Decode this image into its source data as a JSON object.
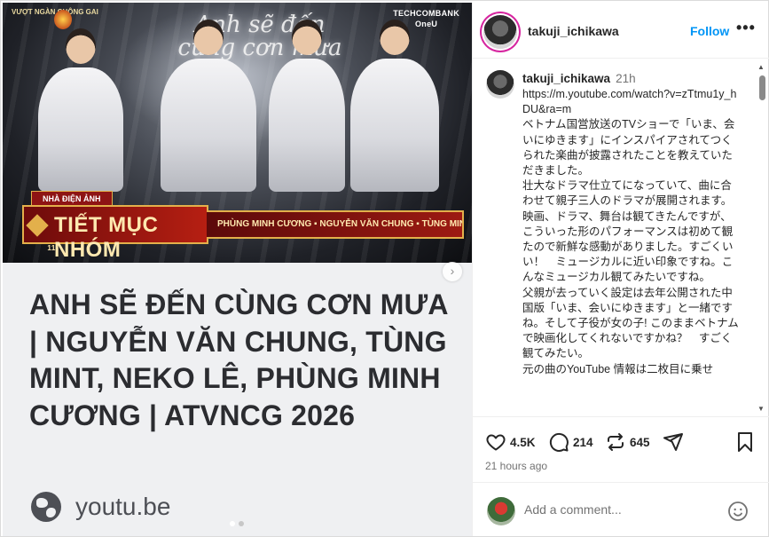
{
  "media": {
    "thumbnail": {
      "show_logo": "VƯỢT NGÀN CHÔNG GAI",
      "sponsor_line1": "TECHCOMBANK",
      "sponsor_line2": "OneU",
      "script_title": "Anh sẽ đến cùng cơn mưa",
      "tag": "NHÀ ĐIỆN ẢNH",
      "banner_title": "TIẾT MỤC NHÓM",
      "banner_number": "11",
      "performers": "PHÙNG MINH CƯƠNG ▪ NGUYỄN VĂN CHUNG ▪ TÙNG MINT ▪ NEKO LÊ"
    },
    "link_title": "ANH SẼ ĐẾN CÙNG CƠN MƯA | NGUYỄN VĂN CHUNG, TÙNG MINT, NEKO LÊ, PHÙNG MINH CƯƠNG | ATVNCG 2026",
    "link_domain": "youtu.be",
    "next_icon": "chevron-right-icon"
  },
  "header": {
    "username": "takuji_ichikawa",
    "follow_label": "Follow",
    "more_label": "•••"
  },
  "caption": {
    "username": "takuji_ichikawa",
    "time": "21h",
    "paragraphs": [
      "https://m.youtube.com/watch?v=zTtmu1y_hDU&ra=m",
      "ベトナム国営放送のTVショーで「いま、会いにゆきます」にインスパイアされてつくられた楽曲が披露されたことを教えていただきました。",
      "壮大なドラマ仕立てになっていて、曲に合わせて親子三人のドラマが展開されます。",
      "映画、ドラマ、舞台は観てきたんですが、こういった形のパフォーマンスは初めて観たので新鮮な感動がありました。すごくいい！　ミュージカルに近い印象ですね。こんなミュージカル観てみたいですね。",
      "父親が去っていく設定は去年公開された中国版「いま、会いにゆきます」と一緒ですね。そして子役が女の子! このままベトナムで映画化してくれないですかね？　すごく観てみたい。",
      "元の曲のYouTube 情報は二枚目に乗せ"
    ]
  },
  "actions": {
    "likes": "4.5K",
    "comments": "214",
    "reposts": "645",
    "posted_ago": "21 hours ago"
  },
  "comment_box": {
    "placeholder": "Add a comment..."
  },
  "colors": {
    "accent": "#0095f6",
    "text": "#262626",
    "muted": "#737373",
    "link_bg": "#eff0f2"
  }
}
